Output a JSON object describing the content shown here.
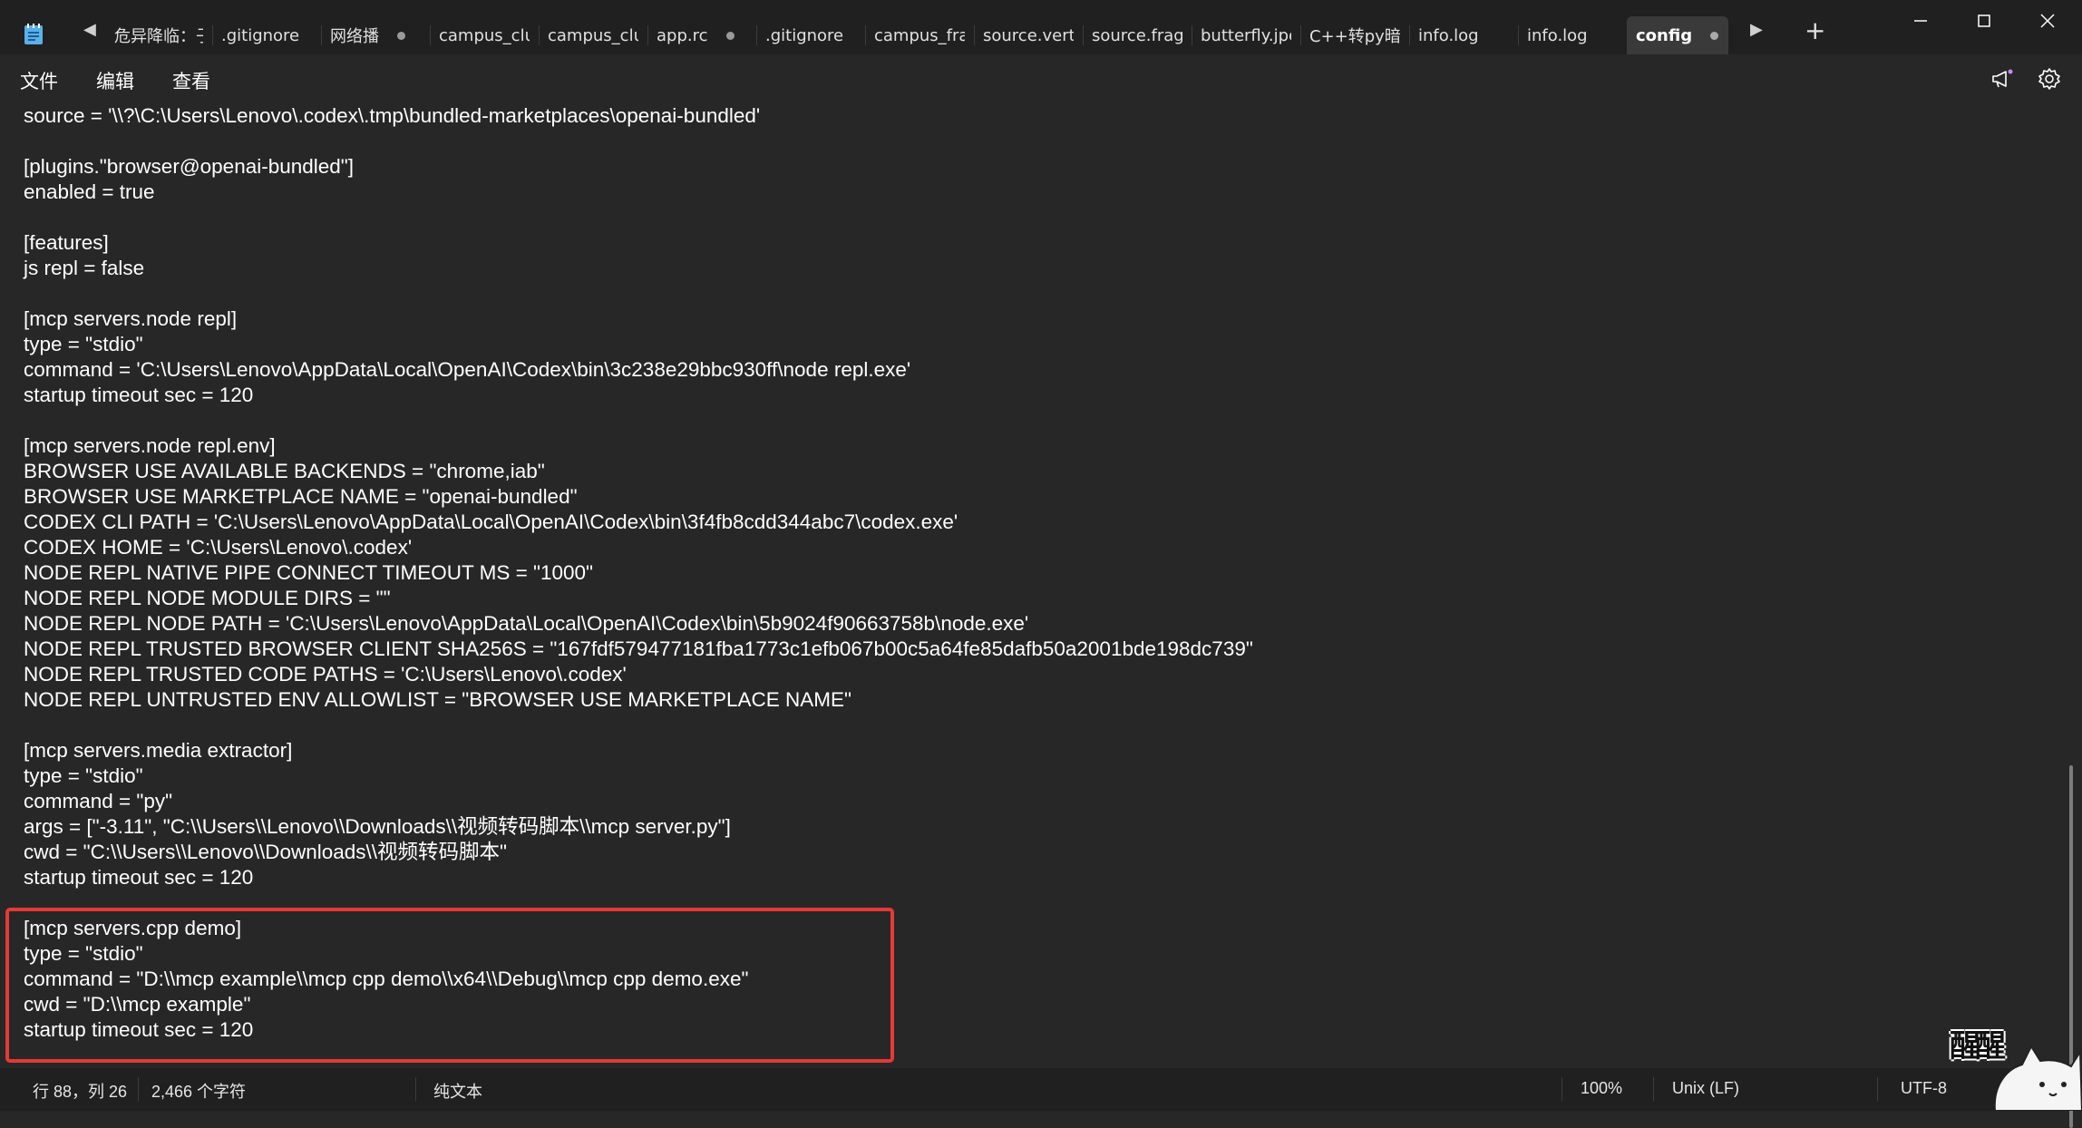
{
  "tabs": [
    {
      "label": "危异降临：子",
      "dot": false
    },
    {
      "label": ".gitignore",
      "dot": false
    },
    {
      "label": "网络播",
      "dot": true
    },
    {
      "label": "campus_club",
      "dot": false
    },
    {
      "label": "campus_club",
      "dot": false
    },
    {
      "label": "app.rc",
      "dot": true
    },
    {
      "label": ".gitignore",
      "dot": false
    },
    {
      "label": "campus_fran",
      "dot": false
    },
    {
      "label": "source.vert",
      "dot": false
    },
    {
      "label": "source.frag",
      "dot": false
    },
    {
      "label": "butterfly.jpeg",
      "dot": false
    },
    {
      "label": "C++转py暗玩",
      "dot": false
    },
    {
      "label": "info.log",
      "dot": false
    },
    {
      "label": "info.log",
      "dot": false
    },
    {
      "label": "config",
      "dot": true,
      "active": true
    }
  ],
  "menu": {
    "file": "文件",
    "edit": "编辑",
    "view": "查看"
  },
  "code_lines": [
    "source = '\\\\?\\C:\\Users\\Lenovo\\.codex\\.tmp\\bundled-marketplaces\\openai-bundled'",
    "",
    "[plugins.\"browser@openai-bundled\"]",
    "enabled = true",
    "",
    "[features]",
    "js repl = false",
    "",
    "[mcp servers.node repl]",
    "type = \"stdio\"",
    "command = 'C:\\Users\\Lenovo\\AppData\\Local\\OpenAI\\Codex\\bin\\3c238e29bbc930ff\\node repl.exe'",
    "startup timeout sec = 120",
    "",
    "[mcp servers.node repl.env]",
    "BROWSER USE AVAILABLE BACKENDS = \"chrome,iab\"",
    "BROWSER USE MARKETPLACE NAME = \"openai-bundled\"",
    "CODEX CLI PATH = 'C:\\Users\\Lenovo\\AppData\\Local\\OpenAI\\Codex\\bin\\3f4fb8cdd344abc7\\codex.exe'",
    "CODEX HOME = 'C:\\Users\\Lenovo\\.codex'",
    "NODE REPL NATIVE PIPE CONNECT TIMEOUT MS = \"1000\"",
    "NODE REPL NODE MODULE DIRS = \"\"",
    "NODE REPL NODE PATH = 'C:\\Users\\Lenovo\\AppData\\Local\\OpenAI\\Codex\\bin\\5b9024f90663758b\\node.exe'",
    "NODE REPL TRUSTED BROWSER CLIENT SHA256S = \"167fdf579477181fba1773c1efb067b00c5a64fe85dafb50a2001bde198dc739\"",
    "NODE REPL TRUSTED CODE PATHS = 'C:\\Users\\Lenovo\\.codex'",
    "NODE REPL UNTRUSTED ENV ALLOWLIST = \"BROWSER USE MARKETPLACE NAME\"",
    "",
    "[mcp servers.media extractor]",
    "type = \"stdio\"",
    "command = \"py\"",
    "args = [\"-3.11\", \"C:\\\\Users\\\\Lenovo\\\\Downloads\\\\视频转码脚本\\\\mcp server.py\"]",
    "cwd = \"C:\\\\Users\\\\Lenovo\\\\Downloads\\\\视频转码脚本\"",
    "startup timeout sec = 120",
    "",
    "[mcp servers.cpp demo]",
    "type = \"stdio\"",
    "command = \"D:\\\\mcp example\\\\mcp cpp demo\\\\x64\\\\Debug\\\\mcp cpp demo.exe\"",
    "cwd = \"D:\\\\mcp example\"",
    "startup timeout sec = 120"
  ],
  "status": {
    "position": "行 88，列 26",
    "char_count": "2,466 个字符",
    "format": "纯文本",
    "zoom": "100%",
    "line_ending": "Unix (LF)",
    "encoding": "UTF-8"
  },
  "watermark": "醒醒",
  "colors": {
    "highlight": "#e53935",
    "background": "#272727",
    "tabbar": "#202020"
  }
}
